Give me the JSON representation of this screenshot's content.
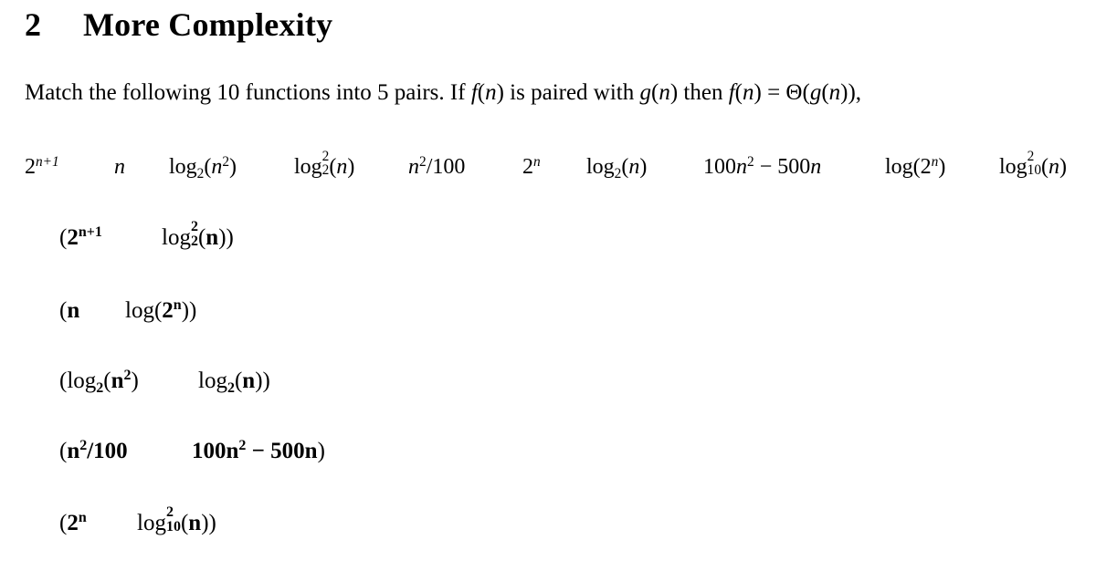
{
  "heading": {
    "number": "2",
    "title": "More Complexity"
  },
  "intro": {
    "text_1": "Match the following 10 functions into 5 pairs. If ",
    "f": "f",
    "n": "n",
    "text_2": " is paired with ",
    "g": "g",
    "text_3": " then ",
    "eq": " = Θ(",
    "end": "),"
  },
  "functions": [
    {
      "id": "f1",
      "display": "2^(n+1)"
    },
    {
      "id": "f2",
      "display": "n"
    },
    {
      "id": "f3",
      "display": "log_2(n^2)"
    },
    {
      "id": "f4",
      "display": "log_2^2(n)"
    },
    {
      "id": "f5",
      "display": "n^2/100"
    },
    {
      "id": "f6",
      "display": "2^n"
    },
    {
      "id": "f7",
      "display": "log_2(n)"
    },
    {
      "id": "f8",
      "display": "100n^2 − 500n"
    },
    {
      "id": "f9",
      "display": "log(2^n)"
    },
    {
      "id": "f10",
      "display": "log_10^2(n)"
    }
  ],
  "pairs": [
    {
      "first": "(2^(n+1)",
      "second": "log_2^2(n))"
    },
    {
      "first": "(n",
      "second": "log(2^n))"
    },
    {
      "first": "(log_2(n^2)",
      "second": "log_2(n))"
    },
    {
      "first": "(n^2/100",
      "second": "100n^2 − 500n)"
    },
    {
      "first": "(2^n",
      "second": "log_10^2(n))"
    }
  ],
  "tokens": {
    "two": "2",
    "n": "n",
    "n_plus_1": "n+1",
    "log": "log",
    "sub2": "2",
    "sub10": "10",
    "sup2": "2",
    "lparen": "(",
    "rparen": ")",
    "rparen2": "))",
    "slash100": "/100",
    "hundred": "100",
    "minus500": " − 500",
    "open": "("
  }
}
